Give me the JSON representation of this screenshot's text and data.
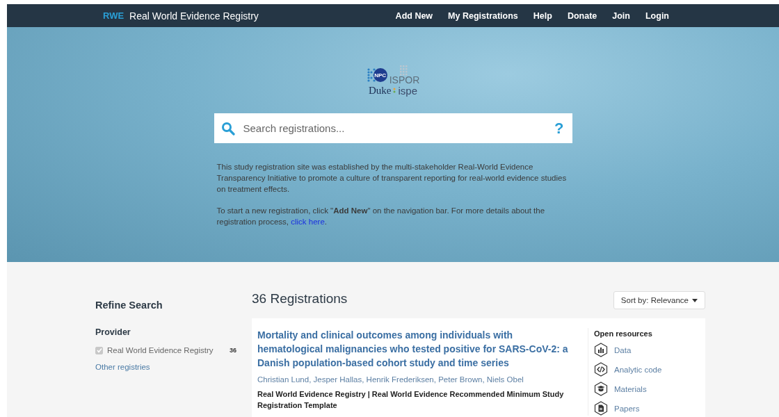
{
  "navbar": {
    "brand_short": "RWE",
    "brand_title": "Real World Evidence Registry",
    "links": [
      {
        "label": "Add New"
      },
      {
        "label": "My Registrations"
      },
      {
        "label": "Help"
      },
      {
        "label": "Donate"
      },
      {
        "label": "Join"
      },
      {
        "label": "Login"
      }
    ]
  },
  "hero": {
    "logo": {
      "npc": "NPC",
      "ispor": "ISPOR",
      "duke": "Duke",
      "ispe": "ispe"
    },
    "search": {
      "placeholder": "Search registrations...",
      "help": "?"
    },
    "intro": "This study registration site was established by the multi-stakeholder Real-World Evidence Transparency Initiative to promote a culture of transparent reporting for real-world evidence studies on treatment effects.",
    "instructions": {
      "text": "To start a new registration, click \"**Add New**\" on the navigation bar. For more details about the registration process, ",
      "link": "click here",
      "end": "."
    }
  },
  "sidebar": {
    "title": "Refine Search",
    "section": "Provider",
    "filters": [
      {
        "label": "Real World Evidence Registry",
        "count": "36",
        "checked": true,
        "disabled": true
      }
    ],
    "more_link": "Other registries"
  },
  "results": {
    "heading": "36 Registrations",
    "sort": "Sort by: Relevance",
    "items": [
      {
        "title": "Mortality and clinical outcomes among individuals with hematological malignancies who tested positive for SARS-CoV-2: a Danish population-based cohort study and time series",
        "authors": "Christian Lund, Jesper Hallas, Henrik Frederiksen, Peter Brown, Niels Obel",
        "source": "Real World Evidence Registry | Real World Evidence Recommended Minimum Study Registration Template",
        "resources_title": "Open resources",
        "resources": [
          {
            "kind": "data",
            "label": "Data"
          },
          {
            "kind": "code",
            "label": "Analytic code"
          },
          {
            "kind": "materials",
            "label": "Materials"
          },
          {
            "kind": "papers",
            "label": "Papers"
          }
        ]
      }
    ]
  }
}
